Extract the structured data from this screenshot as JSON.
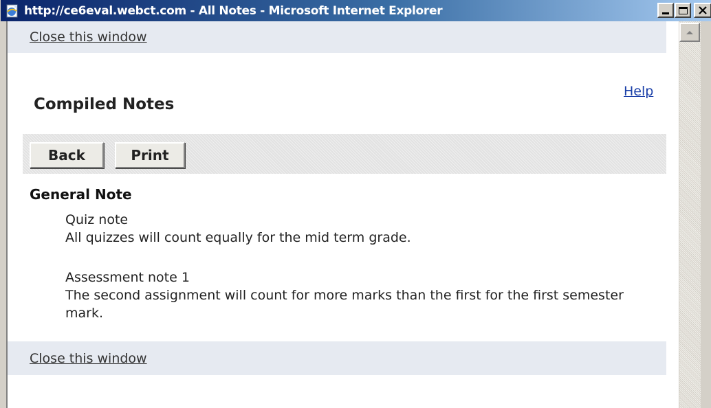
{
  "window": {
    "title": "http://ce6eval.webct.com - All Notes - Microsoft Internet Explorer"
  },
  "links": {
    "close_top": "Close this window",
    "close_bottom": "Close this window",
    "help": "Help"
  },
  "page": {
    "heading": "Compiled Notes"
  },
  "toolbar": {
    "back_label": "Back",
    "print_label": "Print"
  },
  "section": {
    "heading": "General Note",
    "notes": [
      {
        "title": "Quiz note",
        "body": "All quizzes will count equally for the mid term grade."
      },
      {
        "title": "Assessment note 1",
        "body": "The second assignment will count for more marks than the first for the first semester mark."
      }
    ]
  },
  "icons": {
    "title": "ie-page-icon",
    "minimize": "minimize-icon",
    "maximize": "maximize-icon",
    "close": "close-icon",
    "scroll_up": "scroll-up-arrow-icon"
  },
  "colors": {
    "titlebar_start": "#0a246a",
    "titlebar_end": "#a6caf0",
    "close_bar": "#e6eaf1",
    "help_link": "#1a3fa8"
  }
}
